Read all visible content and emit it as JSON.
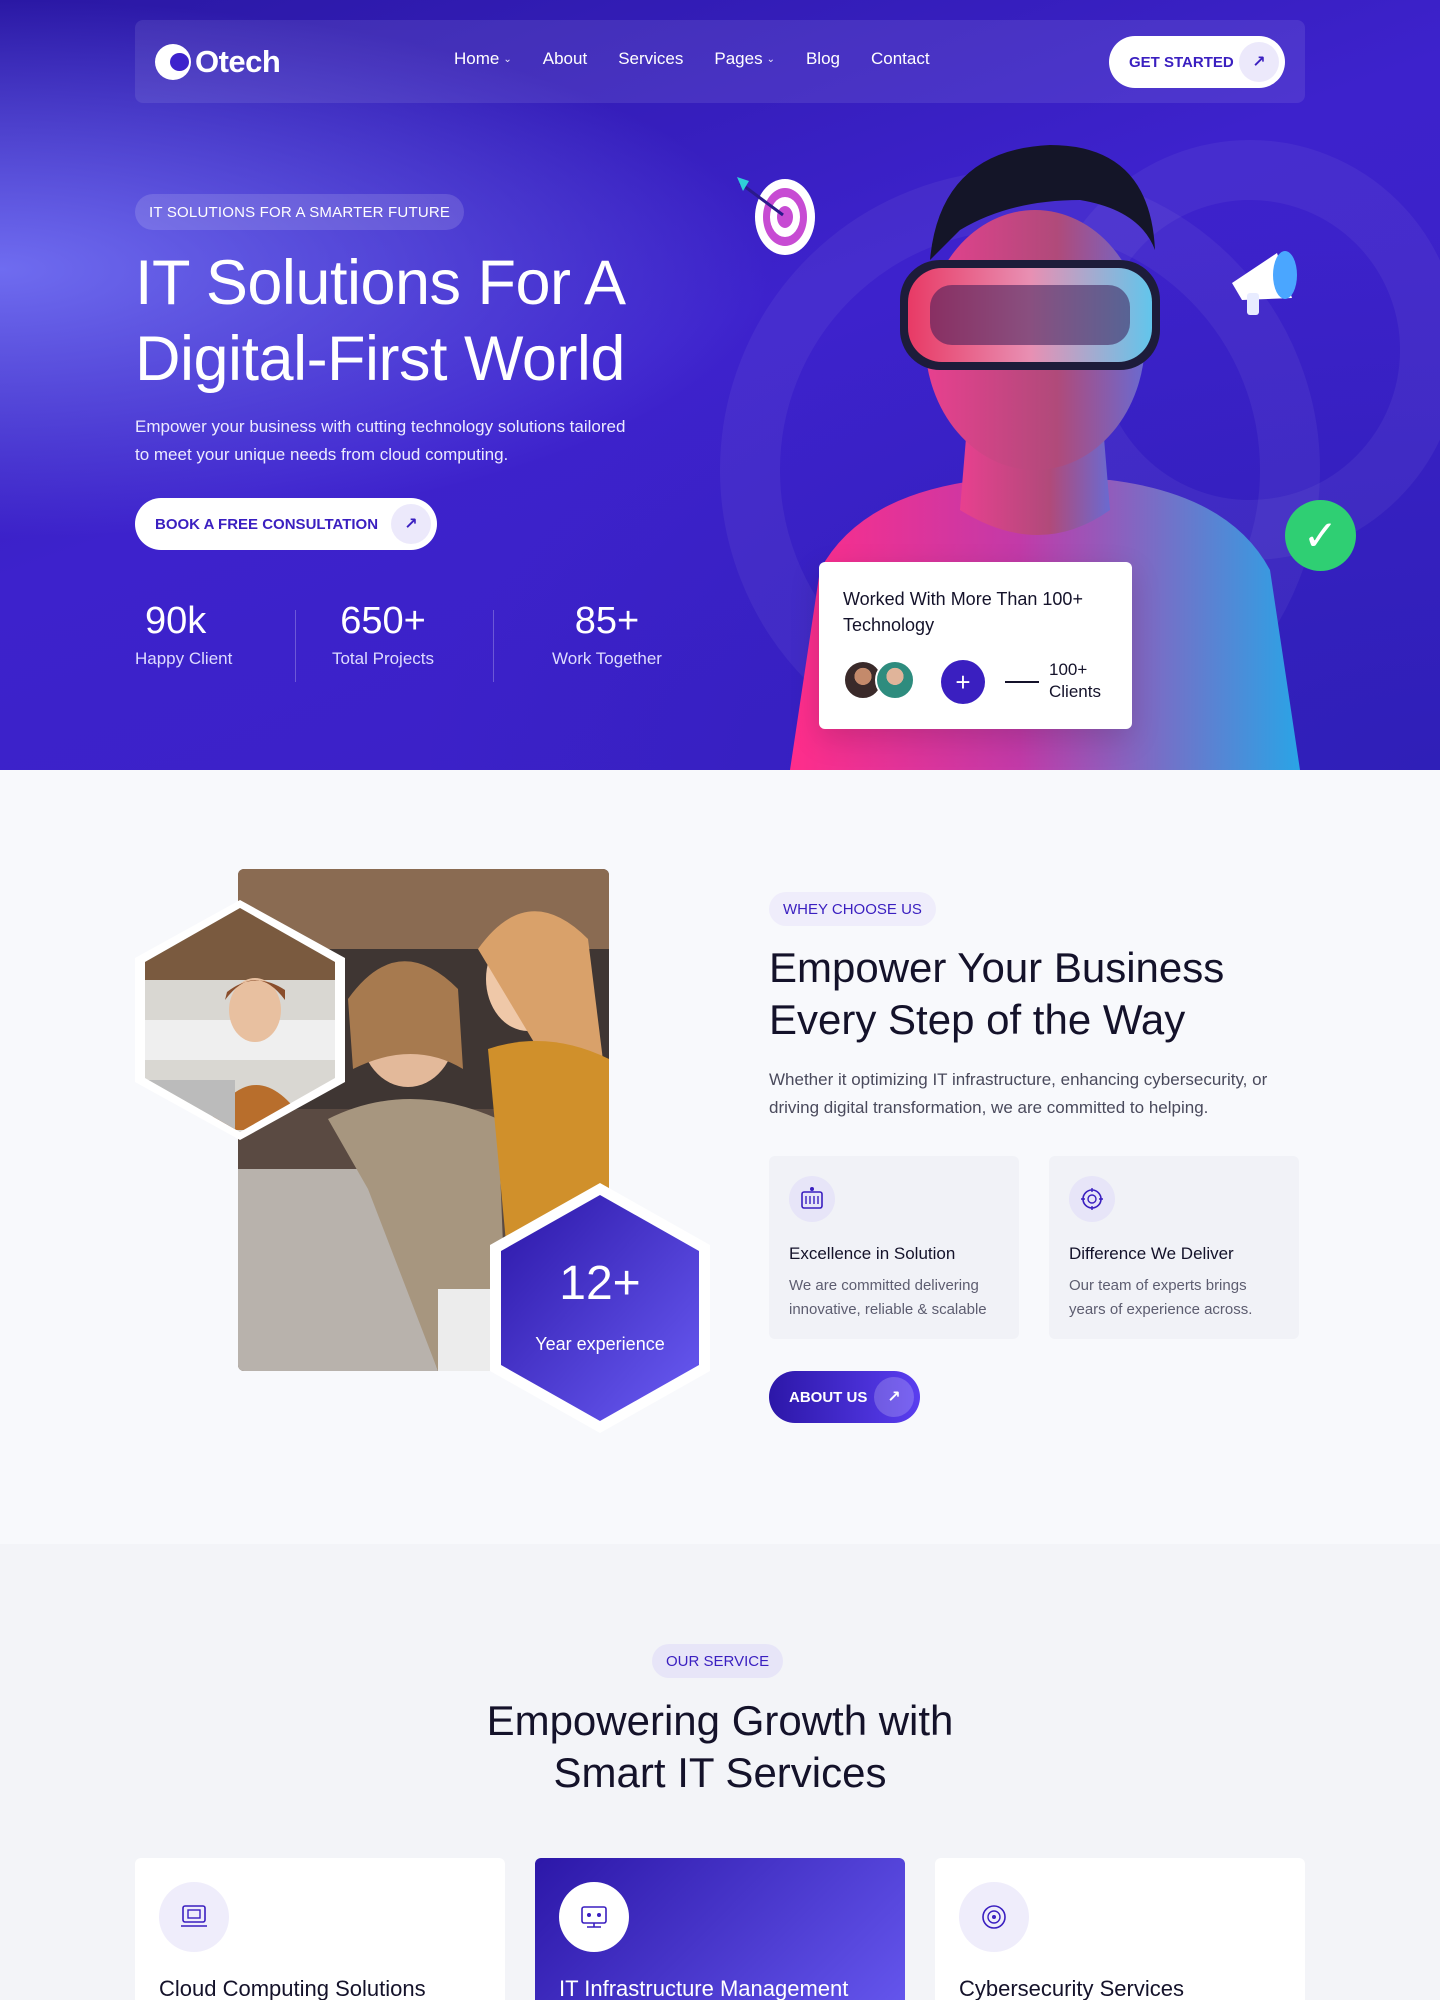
{
  "nav": {
    "brand": "Otech",
    "links": [
      {
        "label": "Home",
        "caret": true
      },
      {
        "label": "About",
        "caret": false
      },
      {
        "label": "Services",
        "caret": false
      },
      {
        "label": "Pages",
        "caret": true
      },
      {
        "label": "Blog",
        "caret": false
      },
      {
        "label": "Contact",
        "caret": false
      }
    ],
    "cta_label": "GET STARTED"
  },
  "hero": {
    "tag": "IT SOLUTIONS FOR A SMARTER FUTURE",
    "title_line1": "IT Solutions For A",
    "title_line2": "Digital-First World",
    "subtitle": "Empower your business with cutting technology solutions tailored to meet your unique needs from cloud computing.",
    "cta_label": "BOOK A FREE CONSULTATION",
    "stats": [
      {
        "value": "90k",
        "label": "Happy Client"
      },
      {
        "value": "650+",
        "label": "Total Projects"
      },
      {
        "value": "85+",
        "label": "Work Together"
      }
    ],
    "tech_card": {
      "title": "Worked With More Than 100+ Technology",
      "clients_line1": "100+",
      "clients_line2": "Clients"
    }
  },
  "about": {
    "tag": "WHEY CHOOSE US",
    "title_line1": "Empower Your Business",
    "title_line2": "Every Step of the Way",
    "description": "Whether it optimizing IT infrastructure, enhancing cybersecurity, or driving digital transformation, we are committed to helping.",
    "experience_value": "12+",
    "experience_label": "Year experience",
    "features": [
      {
        "title": "Excellence in Solution",
        "description": "We are committed delivering innovative, reliable & scalable"
      },
      {
        "title": "Difference We Deliver",
        "description": "Our team of experts brings years of experience across."
      }
    ],
    "cta_label": "ABOUT US"
  },
  "services": {
    "tag": "OUR SERVICE",
    "title_line1": "Empowering Growth with",
    "title_line2": "Smart IT Services",
    "cards": [
      {
        "name": "Cloud Computing Solutions",
        "icon": "cloud-computing-icon",
        "active": false
      },
      {
        "name": "IT Infrastructure Management",
        "icon": "infrastructure-icon",
        "active": true
      },
      {
        "name": "Cybersecurity Services",
        "icon": "cybersecurity-icon",
        "active": false
      }
    ]
  },
  "colors": {
    "primary": "#3a1fc0",
    "hero_bg": "#3d22cc",
    "accent_light": "#efedfb",
    "text_dark": "#14122a",
    "check_green": "#2fcf73"
  }
}
